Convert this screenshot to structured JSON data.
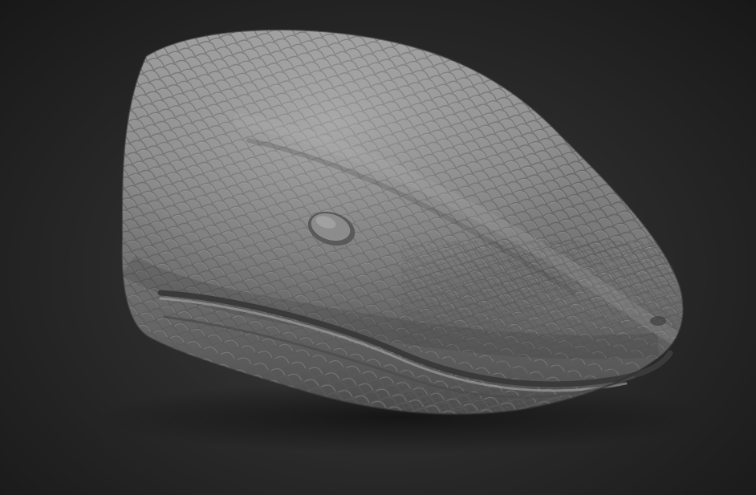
{
  "scene": {
    "subject": "sculpted-snake-head-model",
    "icons": [
      "snake-head-sculpt",
      "eye-socket",
      "mouth-line",
      "scale-texture"
    ],
    "colors": {
      "background_center": "#3e3e3e",
      "background_edge": "#181818",
      "clay_light": "#a2a2a2",
      "clay_mid": "#7d7d7d",
      "clay_dark": "#4c4c4c"
    }
  }
}
